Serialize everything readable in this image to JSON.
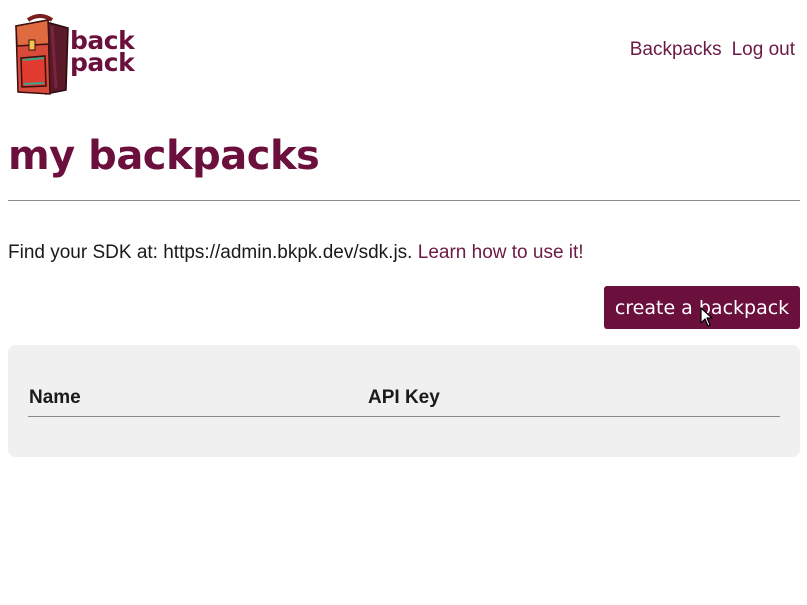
{
  "header": {
    "logo": {
      "line1": "back",
      "line2": "pack"
    },
    "nav": {
      "items": [
        {
          "label": "Backpacks"
        },
        {
          "label": "Log out"
        }
      ]
    }
  },
  "main": {
    "title": "my backpacks",
    "sdk": {
      "prefix": "Find your SDK at: https://admin.bkpk.dev/sdk.js.",
      "link": "Learn how to use it!"
    },
    "create_button": "create a backpack",
    "table": {
      "columns": [
        "Name",
        "API Key"
      ],
      "rows": []
    }
  },
  "colors": {
    "brand": "#6b0f3c",
    "link": "#6b1a45",
    "panel": "#f0f0f1"
  },
  "icons": {
    "logo": "backpack-icon",
    "cursor": "mouse-pointer-icon"
  }
}
